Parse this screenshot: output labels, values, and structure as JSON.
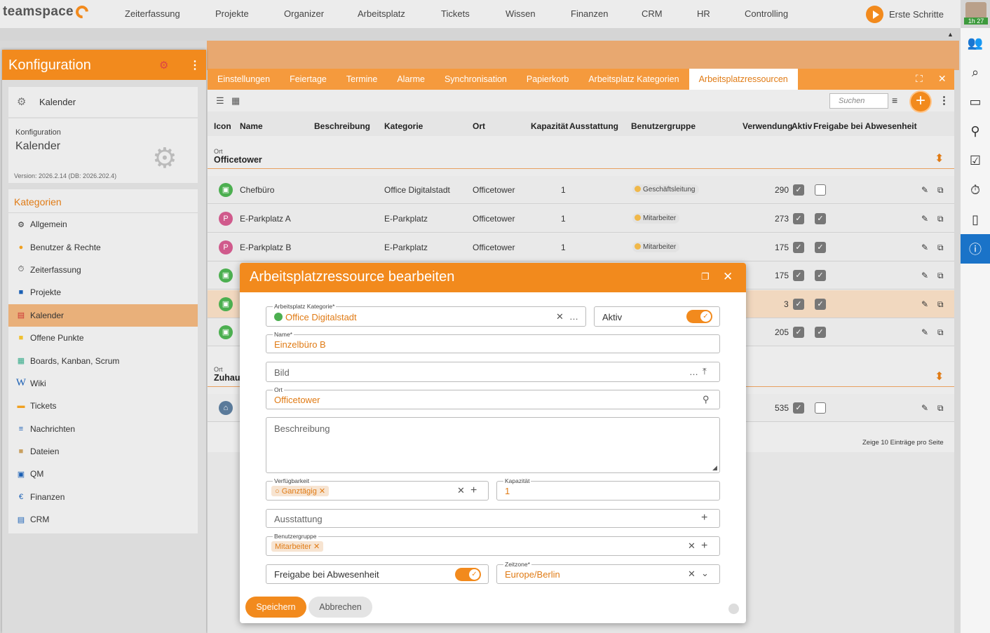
{
  "app": {
    "logo": "teamspace",
    "timer": "1h 27"
  },
  "nav": [
    "Zeiterfassung",
    "Projekte",
    "Organizer",
    "Arbeitsplatz",
    "Tickets",
    "Wissen",
    "Finanzen",
    "CRM",
    "HR",
    "Controlling"
  ],
  "erste_schritte": "Erste Schritte",
  "left_panel": {
    "title": "Konfiguration",
    "calendar_card": "Kalender",
    "konfig_label": "Konfiguration",
    "konfig_value": "Kalender",
    "version": "Version: 2026.2.14 (DB: 2026.202.4)",
    "categories_title": "Kategorien",
    "categories": [
      "Allgemein",
      "Benutzer & Rechte",
      "Zeiterfassung",
      "Projekte",
      "Kalender",
      "Offene Punkte",
      "Boards, Kanban, Scrum",
      "Wiki",
      "Tickets",
      "Nachrichten",
      "Dateien",
      "QM",
      "Finanzen",
      "CRM"
    ],
    "active_category": "Kalender"
  },
  "tabs": [
    "Einstellungen",
    "Feiertage",
    "Termine",
    "Alarme",
    "Synchronisation",
    "Papierkorb",
    "Arbeitsplatz Kategorien",
    "Arbeitsplatzressourcen"
  ],
  "active_tab": "Arbeitsplatzressourcen",
  "toolbar": {
    "search_placeholder": "Suchen"
  },
  "table": {
    "headers": [
      "Icon",
      "Name",
      "Beschreibung",
      "Kategorie",
      "Ort",
      "Kapazität",
      "Ausstattung",
      "Benutzergruppe",
      "Verwendung",
      "Aktiv",
      "Freigabe bei Abwesenheit"
    ],
    "group1_label": "Ort",
    "group1_value": "Officetower",
    "group2_label": "Ort",
    "group2_value": "Zuhaus",
    "rows": [
      {
        "name": "Chefbüro",
        "kategorie": "Office Digitalstadt",
        "ort": "Officetower",
        "kap": "1",
        "gruppe": "Geschäftsleitung",
        "verw": "290",
        "aktiv": true,
        "freigabe": false
      },
      {
        "name": "E-Parkplatz A",
        "kategorie": "E-Parkplatz",
        "ort": "Officetower",
        "kap": "1",
        "gruppe": "Mitarbeiter",
        "verw": "273",
        "aktiv": true,
        "freigabe": true
      },
      {
        "name": "E-Parkplatz B",
        "kategorie": "E-Parkplatz",
        "ort": "Officetower",
        "kap": "1",
        "gruppe": "Mitarbeiter",
        "verw": "175",
        "aktiv": true,
        "freigabe": true
      },
      {
        "name": "",
        "kategorie": "",
        "ort": "",
        "kap": "",
        "gruppe": "",
        "verw": "175",
        "aktiv": true,
        "freigabe": true
      },
      {
        "name": "",
        "kategorie": "",
        "ort": "",
        "kap": "",
        "gruppe": "",
        "verw": "3",
        "aktiv": true,
        "freigabe": true
      },
      {
        "name": "",
        "kategorie": "",
        "ort": "",
        "kap": "",
        "gruppe": "",
        "verw": "205",
        "aktiv": true,
        "freigabe": true
      },
      {
        "name": "",
        "kategorie": "",
        "ort": "",
        "kap": "",
        "gruppe": "",
        "verw": "535",
        "aktiv": true,
        "freigabe": false
      }
    ],
    "footer": "Zeige  10  Einträge pro Seite"
  },
  "dialog": {
    "title": "Arbeitsplatzressource bearbeiten",
    "kategorie_label": "Arbeitsplatz Kategorie*",
    "kategorie_value": "Office Digitalstadt",
    "aktiv_label": "Aktiv",
    "name_label": "Name*",
    "name_value": "Einzelbüro B",
    "bild_placeholder": "Bild",
    "ort_label": "Ort",
    "ort_value": "Officetower",
    "beschreibung_placeholder": "Beschreibung",
    "verfuegbarkeit_label": "Verfügbarkeit",
    "verfuegbarkeit_chip": "Ganztägig",
    "kapazitaet_label": "Kapazität",
    "kapazitaet_value": "1",
    "ausstattung_placeholder": "Ausstattung",
    "benutzergruppe_label": "Benutzergruppe",
    "benutzergruppe_chip": "Mitarbeiter",
    "freigabe_label": "Freigabe bei Abwesenheit",
    "zeitzone_label": "Zeitzone*",
    "zeitzone_value": "Europe/Berlin",
    "save": "Speichern",
    "cancel": "Abbrechen"
  },
  "colors": {
    "accent": "#f28a1d",
    "info": "#1a73c8"
  }
}
